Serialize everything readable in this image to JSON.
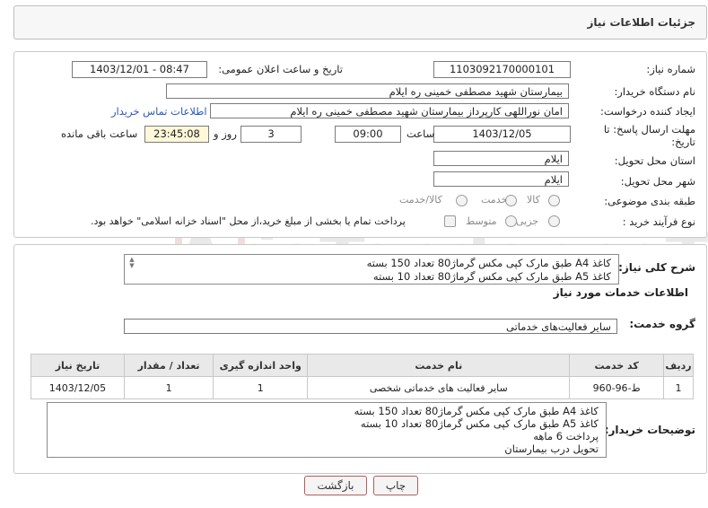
{
  "header": {
    "title": "جزئیات اطلاعات نیاز"
  },
  "form": {
    "need_number_label": "شماره نیاز:",
    "need_number": "1103092170000101",
    "announce_label": "تاریخ و ساعت اعلان عمومی:",
    "announce_value": "1403/12/01 - 08:47",
    "buyer_org_label": "نام دستگاه خریدار:",
    "buyer_org": "بیمارستان شهید مصطفی خمینی  ره  ایلام",
    "requester_label": "ایجاد کننده درخواست:",
    "requester": "امان نوراللهی کارپرداز بیمارستان شهید مصطفی خمینی  ره  ایلام",
    "contact_link": "اطلاعات تماس خریدار",
    "deadline_label_line1": "مهلت ارسال پاسخ: تا",
    "deadline_label_line2": "تاریخ:",
    "deadline_date": "1403/12/05",
    "time_label": "ساعت",
    "deadline_time": "09:00",
    "days_value": "3",
    "days_label": "روز و",
    "remaining_time": "23:45:08",
    "remaining_label": "ساعت باقی مانده",
    "province_label": "استان محل تحویل:",
    "province": "ایلام",
    "city_label": "شهر محل تحویل:",
    "city": "ایلام",
    "category_label": "طبقه بندی موضوعی:",
    "category_options": [
      "کالا",
      "خدمت",
      "کالا/خدمت"
    ],
    "category_selected": "خدمت",
    "purchase_type_label": "نوع فرآیند خرید :",
    "purchase_options": [
      "جزیی",
      "متوسط"
    ],
    "purchase_selected": "جزیی",
    "payment_note": "پرداخت تمام یا بخشی از مبلغ خرید،از محل \"اسناد خزانه اسلامی\" خواهد بود."
  },
  "summary": {
    "label": "شرح کلی نیاز:",
    "lines": [
      "کاغذ A4 طبق مارک کپی مکس گرماژ80 تعداد 150 بسته",
      "کاغذ A5 طبق مارک کپی مکس گرماژ80 تعداد 10 بسته"
    ]
  },
  "services": {
    "section_title": "اطلاعات خدمات مورد نیاز",
    "group_label": "گروه خدمت:",
    "group_value": "سایر فعالیت‌های خدماتی",
    "columns": [
      "ردیف",
      "کد خدمت",
      "نام خدمت",
      "واحد اندازه گیری",
      "تعداد / مقدار",
      "تاریخ نیاز"
    ],
    "rows": [
      [
        "1",
        "ط-96-960",
        "سایر فعالیت های خدماتی شخصی",
        "1",
        "1",
        "1403/12/05"
      ]
    ]
  },
  "buyer_notes": {
    "label": "توضیحات خریدار:",
    "lines": [
      "کاغذ A4 طبق مارک کپی مکس گرماژ80 تعداد 150 بسته",
      "کاغذ A5 طبق مارک کپی مکس گرماژ80 تعداد 10 بسته",
      "پرداخت 6 ماهه",
      "تحویل درب بیمارستان"
    ]
  },
  "buttons": {
    "print": "چاپ",
    "back": "بازگشت"
  },
  "watermark": "AriaTender.neT",
  "colors": {
    "highlight_field": "#fff7d9",
    "link": "#2a59b8",
    "button_border": "#b65b5b"
  }
}
